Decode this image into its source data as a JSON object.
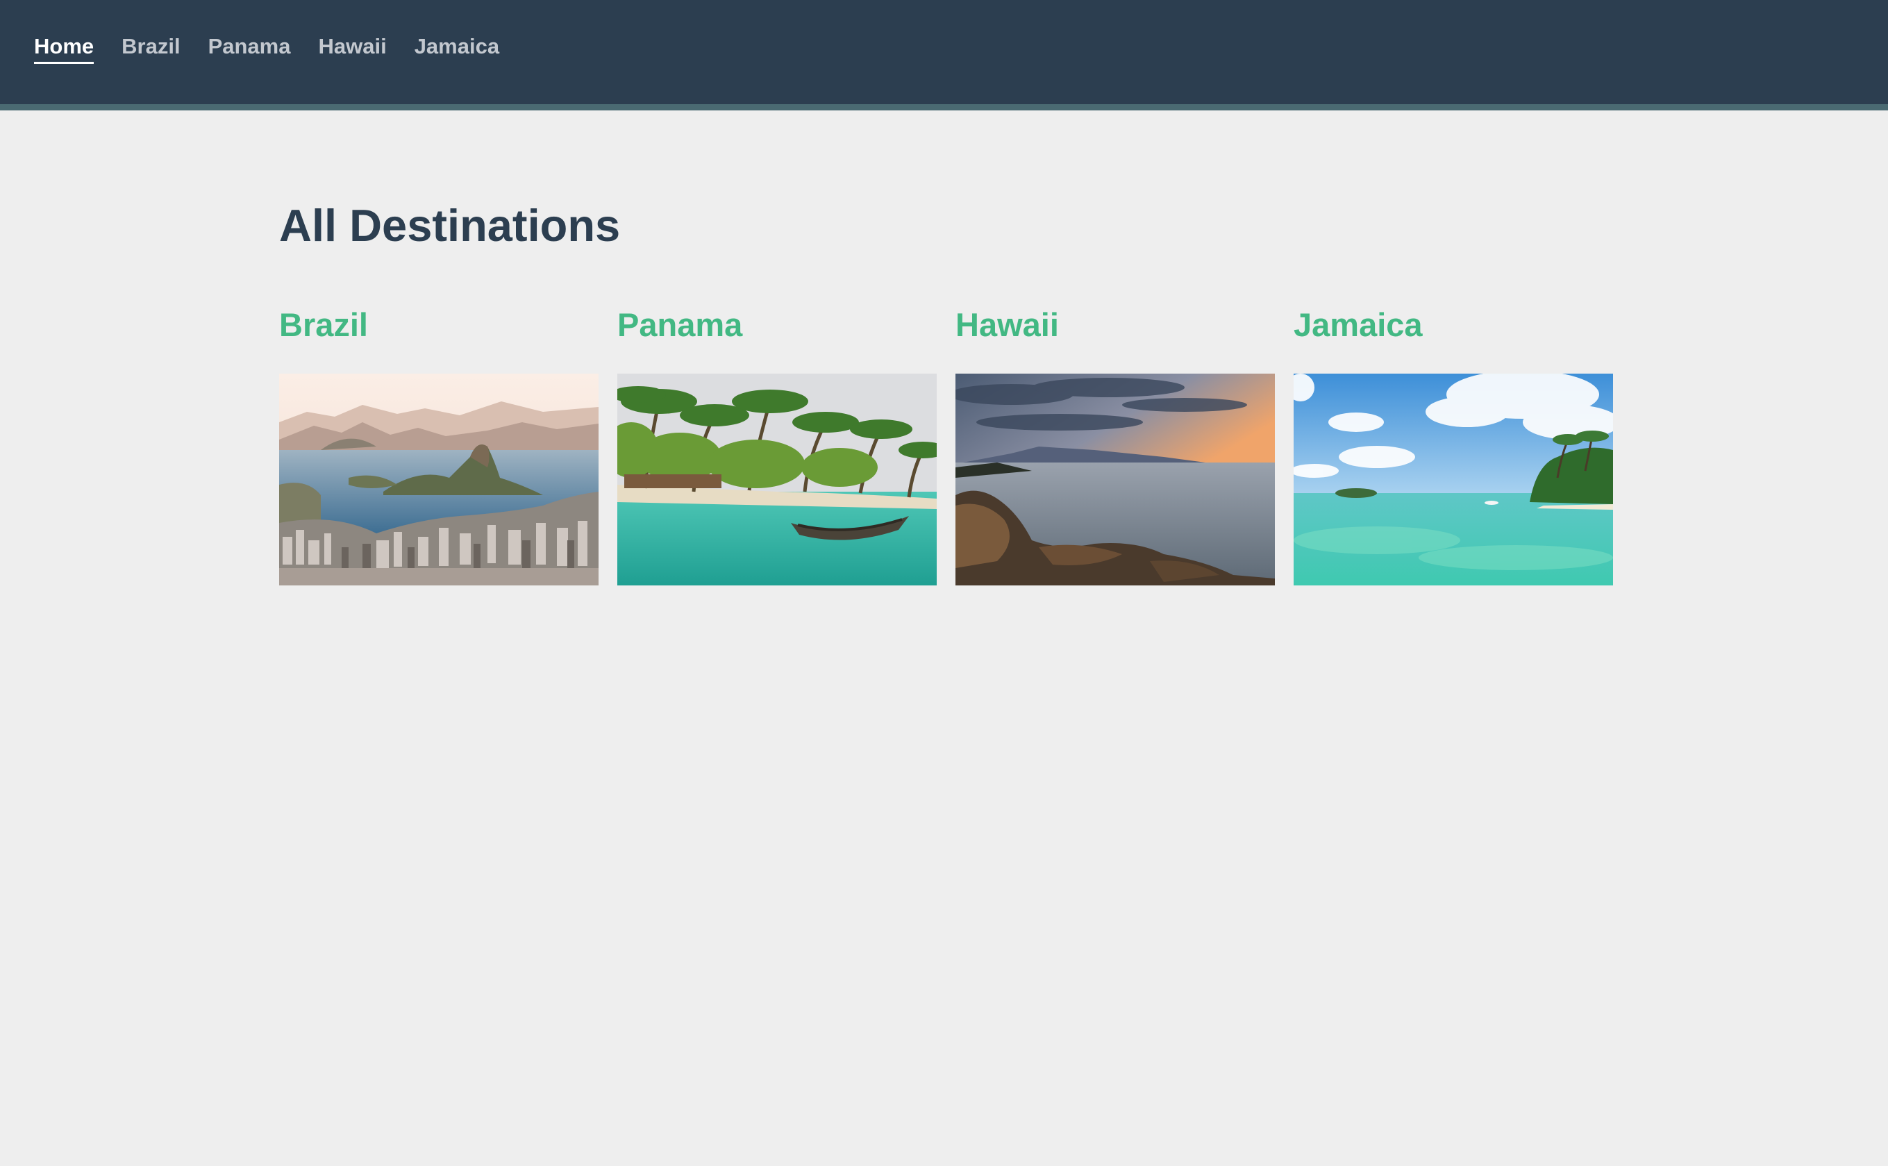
{
  "nav": {
    "links": [
      {
        "label": "Home",
        "active": true
      },
      {
        "label": "Brazil",
        "active": false
      },
      {
        "label": "Panama",
        "active": false
      },
      {
        "label": "Hawaii",
        "active": false
      },
      {
        "label": "Jamaica",
        "active": false
      }
    ]
  },
  "main": {
    "title": "All Destinations",
    "destinations": [
      {
        "name": "Brazil",
        "image": "rio-de-janeiro-sugarloaf-photo"
      },
      {
        "name": "Panama",
        "image": "palm-beach-canoe-photo"
      },
      {
        "name": "Hawaii",
        "image": "rocky-coast-sunset-photo"
      },
      {
        "name": "Jamaica",
        "image": "turquoise-lagoon-island-photo"
      }
    ]
  },
  "colors": {
    "navbar": "#2c3e50",
    "navbar_border": "#4a6a72",
    "background": "#eeeeee",
    "title": "#2c3e50",
    "accent": "#42b883",
    "nav_text": "#c3c8cf",
    "nav_active": "#ffffff"
  }
}
